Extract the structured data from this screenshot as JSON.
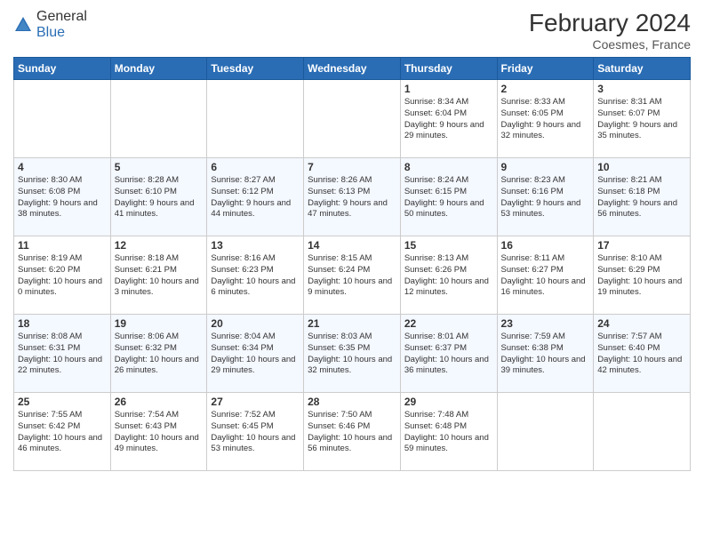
{
  "header": {
    "logo_general": "General",
    "logo_blue": "Blue",
    "month_year": "February 2024",
    "location": "Coesmes, France"
  },
  "days_of_week": [
    "Sunday",
    "Monday",
    "Tuesday",
    "Wednesday",
    "Thursday",
    "Friday",
    "Saturday"
  ],
  "weeks": [
    [
      {
        "day": "",
        "info": ""
      },
      {
        "day": "",
        "info": ""
      },
      {
        "day": "",
        "info": ""
      },
      {
        "day": "",
        "info": ""
      },
      {
        "day": "1",
        "info": "Sunrise: 8:34 AM\nSunset: 6:04 PM\nDaylight: 9 hours and 29 minutes."
      },
      {
        "day": "2",
        "info": "Sunrise: 8:33 AM\nSunset: 6:05 PM\nDaylight: 9 hours and 32 minutes."
      },
      {
        "day": "3",
        "info": "Sunrise: 8:31 AM\nSunset: 6:07 PM\nDaylight: 9 hours and 35 minutes."
      }
    ],
    [
      {
        "day": "4",
        "info": "Sunrise: 8:30 AM\nSunset: 6:08 PM\nDaylight: 9 hours and 38 minutes."
      },
      {
        "day": "5",
        "info": "Sunrise: 8:28 AM\nSunset: 6:10 PM\nDaylight: 9 hours and 41 minutes."
      },
      {
        "day": "6",
        "info": "Sunrise: 8:27 AM\nSunset: 6:12 PM\nDaylight: 9 hours and 44 minutes."
      },
      {
        "day": "7",
        "info": "Sunrise: 8:26 AM\nSunset: 6:13 PM\nDaylight: 9 hours and 47 minutes."
      },
      {
        "day": "8",
        "info": "Sunrise: 8:24 AM\nSunset: 6:15 PM\nDaylight: 9 hours and 50 minutes."
      },
      {
        "day": "9",
        "info": "Sunrise: 8:23 AM\nSunset: 6:16 PM\nDaylight: 9 hours and 53 minutes."
      },
      {
        "day": "10",
        "info": "Sunrise: 8:21 AM\nSunset: 6:18 PM\nDaylight: 9 hours and 56 minutes."
      }
    ],
    [
      {
        "day": "11",
        "info": "Sunrise: 8:19 AM\nSunset: 6:20 PM\nDaylight: 10 hours and 0 minutes."
      },
      {
        "day": "12",
        "info": "Sunrise: 8:18 AM\nSunset: 6:21 PM\nDaylight: 10 hours and 3 minutes."
      },
      {
        "day": "13",
        "info": "Sunrise: 8:16 AM\nSunset: 6:23 PM\nDaylight: 10 hours and 6 minutes."
      },
      {
        "day": "14",
        "info": "Sunrise: 8:15 AM\nSunset: 6:24 PM\nDaylight: 10 hours and 9 minutes."
      },
      {
        "day": "15",
        "info": "Sunrise: 8:13 AM\nSunset: 6:26 PM\nDaylight: 10 hours and 12 minutes."
      },
      {
        "day": "16",
        "info": "Sunrise: 8:11 AM\nSunset: 6:27 PM\nDaylight: 10 hours and 16 minutes."
      },
      {
        "day": "17",
        "info": "Sunrise: 8:10 AM\nSunset: 6:29 PM\nDaylight: 10 hours and 19 minutes."
      }
    ],
    [
      {
        "day": "18",
        "info": "Sunrise: 8:08 AM\nSunset: 6:31 PM\nDaylight: 10 hours and 22 minutes."
      },
      {
        "day": "19",
        "info": "Sunrise: 8:06 AM\nSunset: 6:32 PM\nDaylight: 10 hours and 26 minutes."
      },
      {
        "day": "20",
        "info": "Sunrise: 8:04 AM\nSunset: 6:34 PM\nDaylight: 10 hours and 29 minutes."
      },
      {
        "day": "21",
        "info": "Sunrise: 8:03 AM\nSunset: 6:35 PM\nDaylight: 10 hours and 32 minutes."
      },
      {
        "day": "22",
        "info": "Sunrise: 8:01 AM\nSunset: 6:37 PM\nDaylight: 10 hours and 36 minutes."
      },
      {
        "day": "23",
        "info": "Sunrise: 7:59 AM\nSunset: 6:38 PM\nDaylight: 10 hours and 39 minutes."
      },
      {
        "day": "24",
        "info": "Sunrise: 7:57 AM\nSunset: 6:40 PM\nDaylight: 10 hours and 42 minutes."
      }
    ],
    [
      {
        "day": "25",
        "info": "Sunrise: 7:55 AM\nSunset: 6:42 PM\nDaylight: 10 hours and 46 minutes."
      },
      {
        "day": "26",
        "info": "Sunrise: 7:54 AM\nSunset: 6:43 PM\nDaylight: 10 hours and 49 minutes."
      },
      {
        "day": "27",
        "info": "Sunrise: 7:52 AM\nSunset: 6:45 PM\nDaylight: 10 hours and 53 minutes."
      },
      {
        "day": "28",
        "info": "Sunrise: 7:50 AM\nSunset: 6:46 PM\nDaylight: 10 hours and 56 minutes."
      },
      {
        "day": "29",
        "info": "Sunrise: 7:48 AM\nSunset: 6:48 PM\nDaylight: 10 hours and 59 minutes."
      },
      {
        "day": "",
        "info": ""
      },
      {
        "day": "",
        "info": ""
      }
    ]
  ]
}
